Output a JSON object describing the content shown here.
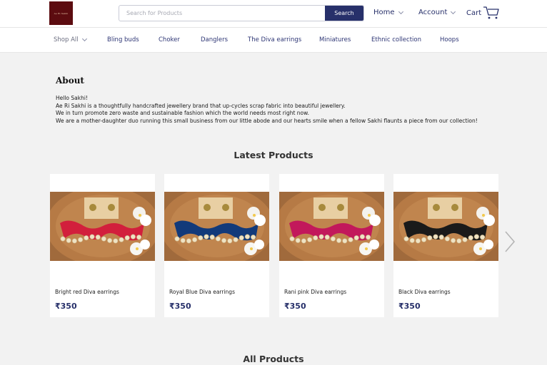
{
  "header": {
    "logo_text": "Ae Ri Sakhi",
    "search": {
      "placeholder": "Search for Products",
      "value": "",
      "button_label": "Search"
    },
    "nav": {
      "home": "Home",
      "account": "Account",
      "cart": "Cart"
    }
  },
  "categories": [
    "Shop All",
    "Bling buds",
    "Choker",
    "Danglers",
    "The Diva earrings",
    "Miniatures",
    "Ethnic collection",
    "Hoops"
  ],
  "about": {
    "title": "About",
    "lines": [
      "Hello Sakhi!",
      "Ae Ri Sakhi is a thoughtfully handcrafted jewellery brand that up-cycles scrap fabric into beautiful jewellery.",
      "We in turn promote zero waste and sustainable fashion which the world needs most right now.",
      "We are a mother-daughter duo running this small business from our little abode and our hearts smile when a fellow Sakhi flaunts a piece from our collection!"
    ]
  },
  "latest": {
    "title": "Latest Products",
    "products": [
      {
        "name": "Bright red Diva earrings",
        "price": "₹350",
        "color": "#d21f3c"
      },
      {
        "name": "Royal Blue Diva earrings",
        "price": "₹350",
        "color": "#123a7a"
      },
      {
        "name": "Rani pink Diva earrings",
        "price": "₹350",
        "color": "#c2185b"
      },
      {
        "name": "Black Diva earrings",
        "price": "₹350",
        "color": "#1a1a1a"
      }
    ]
  },
  "all_products": {
    "title": "All Products"
  },
  "colors": {
    "brand": "#27306a",
    "logo_bg": "#5c0c10",
    "page_bg": "#f2f2f2"
  }
}
